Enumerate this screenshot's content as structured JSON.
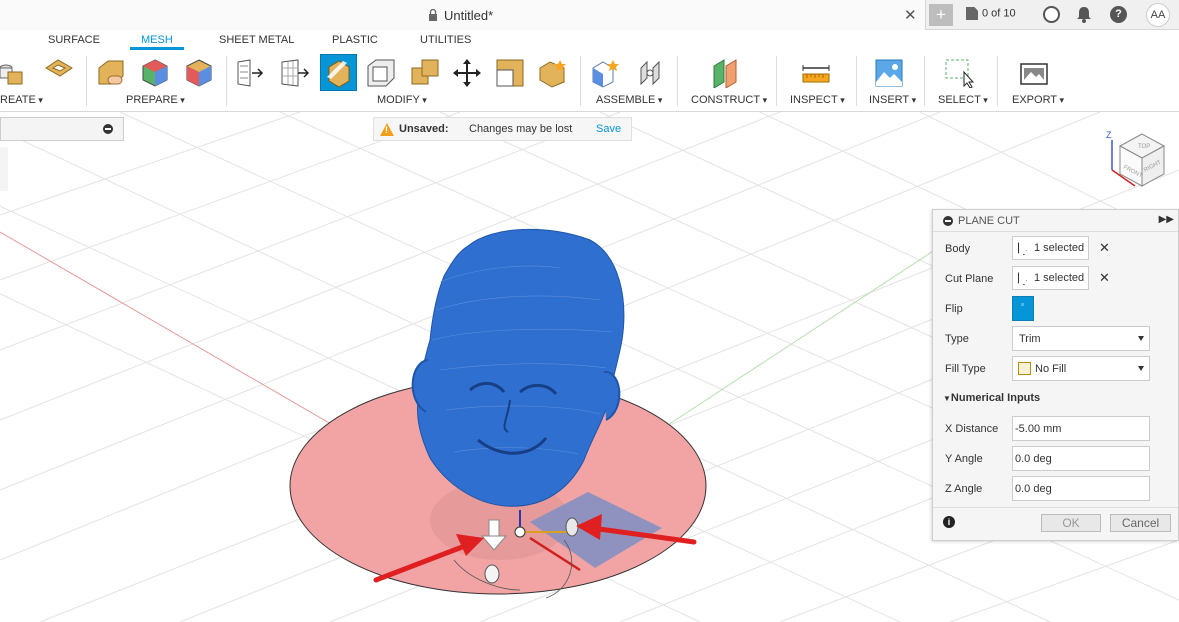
{
  "titlebar": {
    "doc_title": "Untitled*",
    "close_icon": "close-icon",
    "new_tab_label": "+",
    "jobs_label": "0 of 10",
    "avatar_initials": "AA",
    "help_label": "?"
  },
  "ribbon": {
    "tabs": [
      "SURFACE",
      "MESH",
      "SHEET METAL",
      "PLASTIC",
      "UTILITIES"
    ],
    "active_tab": "MESH",
    "groups": [
      "REATE",
      "PREPARE",
      "MODIFY",
      "ASSEMBLE",
      "CONSTRUCT",
      "INSPECT",
      "INSERT",
      "SELECT",
      "EXPORT"
    ],
    "accent_color": "#0696d7"
  },
  "unsaved": {
    "label": "Unsaved:",
    "message": "Changes may be lost",
    "save_link": "Save"
  },
  "viewcube": {
    "face_top": "TOP",
    "face_front": "FRONT",
    "face_right": "RIGHT",
    "axis": "Z"
  },
  "dialog": {
    "title": "PLANE CUT",
    "body_label": "Body",
    "body_value": "1 selected",
    "cutplane_label": "Cut Plane",
    "cutplane_value": "1 selected",
    "flip_label": "Flip",
    "type_label": "Type",
    "type_value": "Trim",
    "filltype_label": "Fill Type",
    "filltype_value": "No Fill",
    "numerical_label": "Numerical Inputs",
    "xdist_label": "X Distance",
    "xdist_value": "-5.00 mm",
    "yangle_label": "Y Angle",
    "yangle_value": "0.0 deg",
    "zangle_label": "Z Angle",
    "zangle_value": "0.0 deg",
    "ok_label": "OK",
    "cancel_label": "Cancel"
  }
}
